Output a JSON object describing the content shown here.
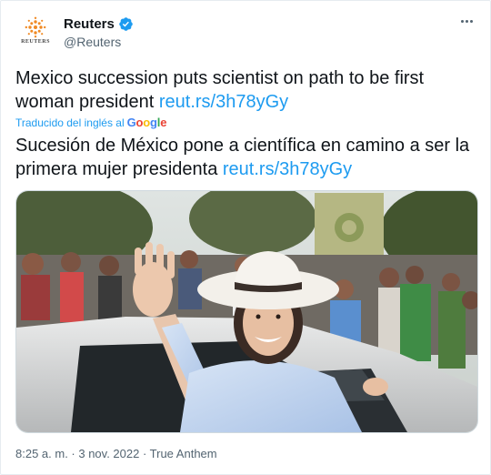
{
  "account": {
    "name": "Reuters",
    "handle": "@Reuters",
    "avatar_wordmark": "REUTERS",
    "verified_icon": "verified-badge-icon"
  },
  "tweet": {
    "text_original": "Mexico succession puts scientist on path to be first woman president",
    "link": "reut.rs/3h78yGy",
    "translated_label": "Traducido del inglés al",
    "translator_brand": "Google",
    "text_translated": "Sucesión de México pone a científica en camino a ser la primera mujer presidenta",
    "timestamp": "8:25 a. m. · 3 nov. 2022 · True Anthem"
  },
  "media": {
    "banner_text": "~"
  },
  "colors": {
    "link": "#1d9bf0",
    "secondary_text": "#536471",
    "primary_text": "#0f1419"
  }
}
